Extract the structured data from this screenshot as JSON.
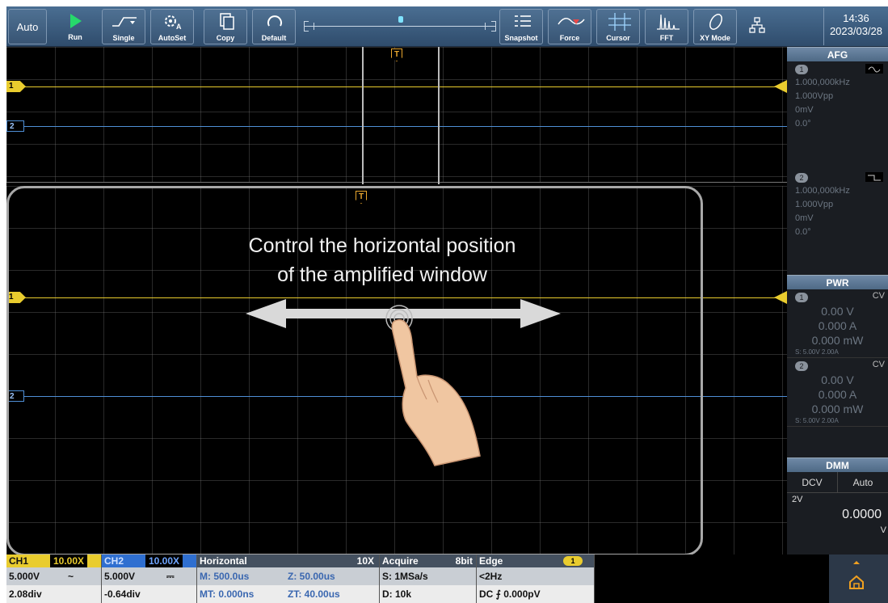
{
  "toolbar": {
    "auto": "Auto",
    "run": "Run",
    "single": "Single",
    "autoset": "AutoSet",
    "copy": "Copy",
    "default": "Default",
    "snapshot": "Snapshot",
    "force": "Force",
    "cursor": "Cursor",
    "fft": "FFT",
    "xy_mode": "XY Mode",
    "time": "14:36",
    "date": "2023/03/28"
  },
  "screen": {
    "ch1_tag": "1",
    "ch2_tag": "2",
    "trigger_tag": "T",
    "callout_line1": "Control the horizontal position",
    "callout_line2": "of the amplified window"
  },
  "afg": {
    "title": "AFG",
    "ch1": {
      "badge": "1",
      "freq": "1.000,000kHz",
      "amp": "1.000Vpp",
      "offset": "0mV",
      "phase": "0.0°"
    },
    "ch2": {
      "badge": "2",
      "freq": "1.000,000kHz",
      "amp": "1.000Vpp",
      "offset": "0mV",
      "phase": "0.0°"
    }
  },
  "pwr": {
    "title": "PWR",
    "ch1": {
      "badge": "1",
      "mode": "CV",
      "voltage": "0.00 V",
      "current": "0.000 A",
      "power": "0.000 mW",
      "setting": "S: 5.00V 2.00A"
    },
    "ch2": {
      "badge": "2",
      "mode": "CV",
      "voltage": "0.00 V",
      "current": "0.000 A",
      "power": "0.000 mW",
      "setting": "S: 5.00V 2.00A"
    }
  },
  "dmm": {
    "title": "DMM",
    "mode": "DCV",
    "range_mode": "Auto",
    "range": "2V",
    "value": "0.0000",
    "unit": "V"
  },
  "status": {
    "ch1": {
      "label": "CH1",
      "probe": "10.00X",
      "scale": "5.000V",
      "coupling": "~",
      "offset": "2.08div"
    },
    "ch2": {
      "label": "CH2",
      "probe": "10.00X",
      "scale": "5.000V",
      "coupling": "⎓",
      "offset": "-0.64div"
    },
    "horizontal": {
      "label": "Horizontal",
      "zoom": "10X",
      "main": "M: 500.0us",
      "zoomed": "Z: 50.00us",
      "main_trig": "MT: 0.000ns",
      "zoom_trig": "ZT: 40.00us"
    },
    "acquire": {
      "label": "Acquire",
      "bits": "8bit",
      "rate": "S: 1MSa/s",
      "depth": "D: 10k"
    },
    "trigger": {
      "label": "Edge",
      "source": "1",
      "freq": "<2Hz",
      "level": "DC ⨍ 0.000pV"
    }
  },
  "colors": {
    "ch1": "#e9cc2e",
    "ch2": "#4f8fd6",
    "toolbar": "#3d5d7f"
  }
}
